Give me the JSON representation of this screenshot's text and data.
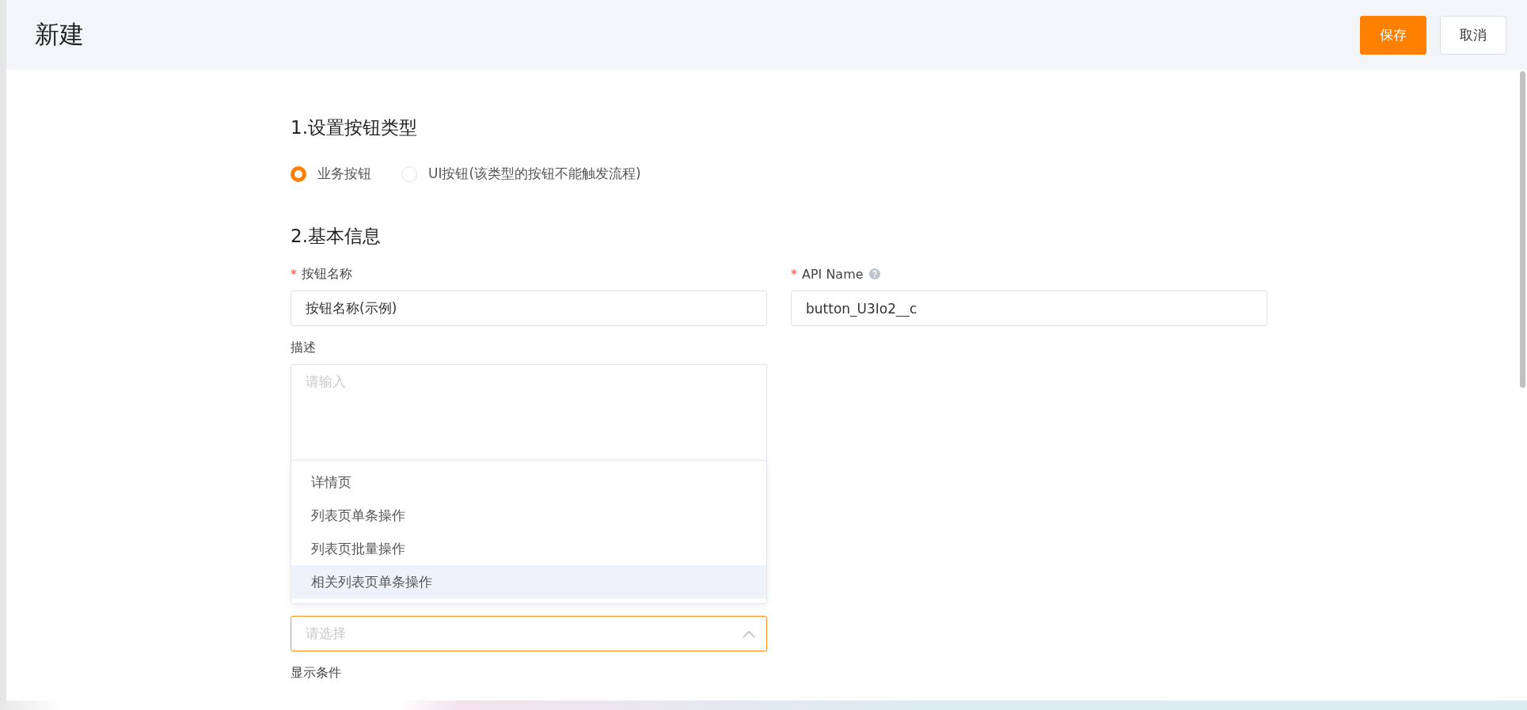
{
  "header": {
    "title": "新建",
    "buttons": [
      {
        "label": "保存",
        "kind": "primary"
      },
      {
        "label": "取消",
        "kind": "default"
      }
    ]
  },
  "section_1": {
    "title": "1.设置按钮类型",
    "radios": [
      {
        "label": "业务按钮",
        "selected": true
      },
      {
        "label": "UI按钮(该类型的按钮不能触发流程)",
        "selected": false
      }
    ]
  },
  "section_2": {
    "title": "2.基本信息",
    "name_field": {
      "label": "按钮名称",
      "required_mark": "*",
      "value": "按钮名称(示例)"
    },
    "api_field": {
      "label": "API Name",
      "required_mark": "*",
      "value": "button_U3Io2__c"
    },
    "description_field": {
      "label": "描述",
      "placeholder": "请输入"
    },
    "position_select": {
      "placeholder": "请选择",
      "expanded": true,
      "options": [
        {
          "label": "详情页",
          "selected": false
        },
        {
          "label": "列表页单条操作",
          "selected": false
        },
        {
          "label": "列表页批量操作",
          "selected": false
        },
        {
          "label": "相关列表页单条操作",
          "selected": true
        }
      ]
    },
    "display_label": "显示条件"
  }
}
